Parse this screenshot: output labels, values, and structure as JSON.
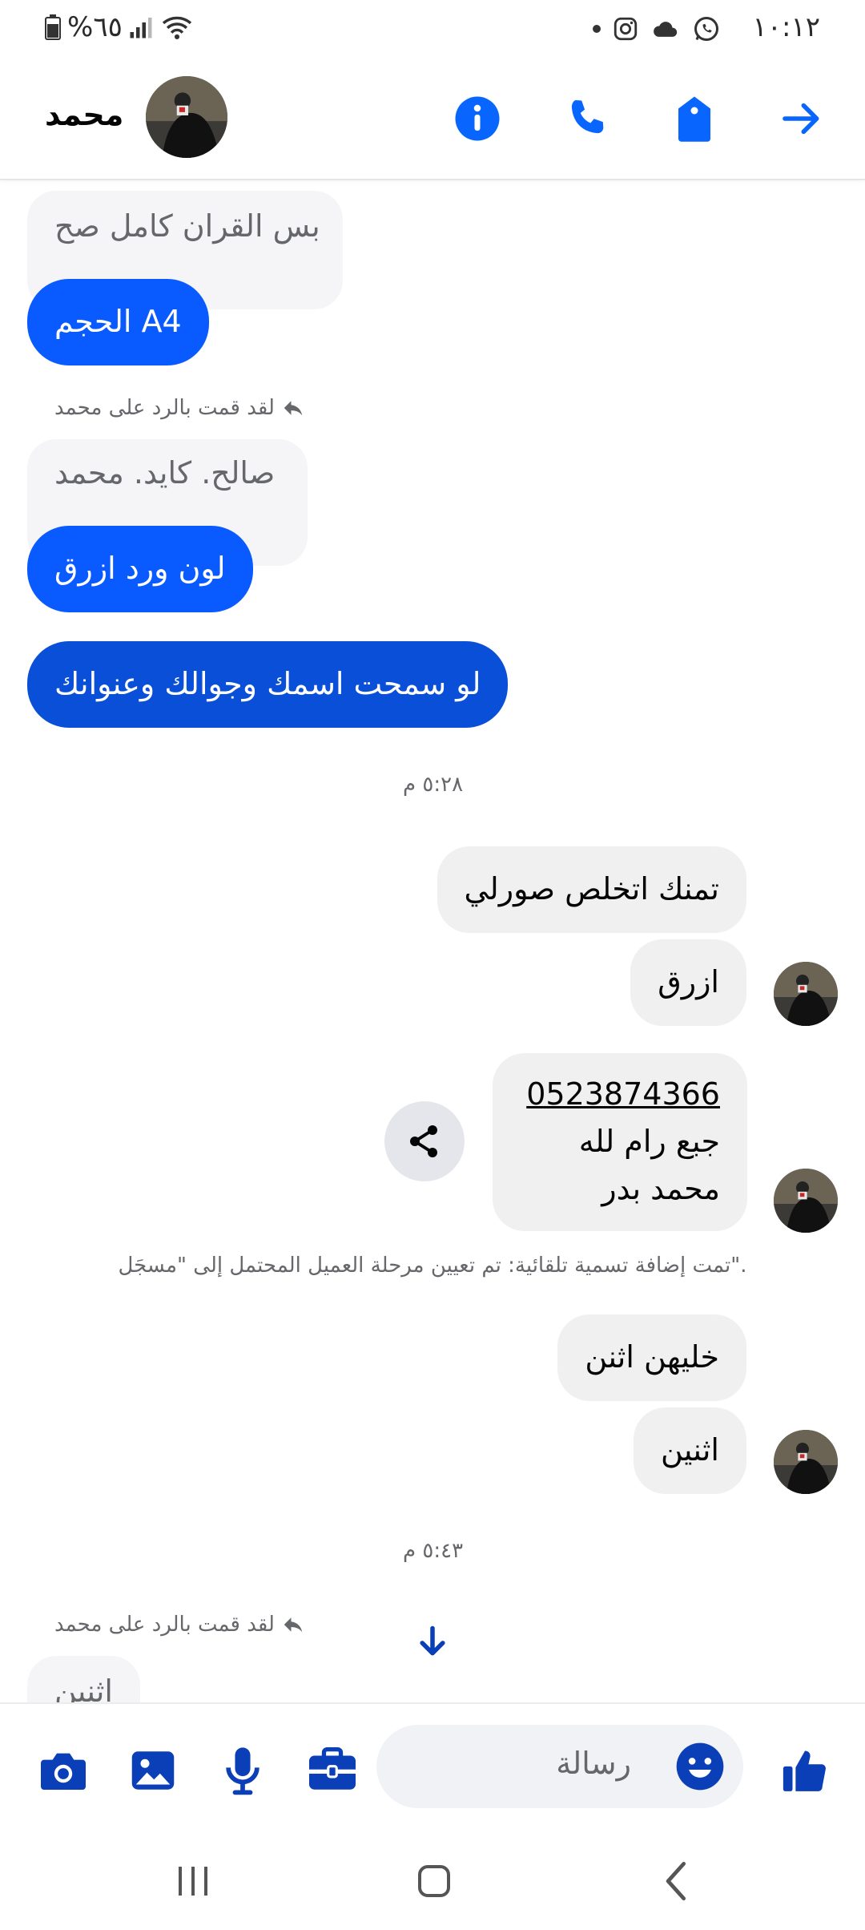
{
  "status_bar": {
    "time": "١٠:١٢",
    "battery": "%٦٥",
    "icons": [
      "dot",
      "instagram-icon",
      "cloud-icon",
      "whatsapp-icon",
      "signal-icon",
      "wifi-icon",
      "battery-icon"
    ]
  },
  "header": {
    "contact_name": "محمد",
    "icons": [
      "info-icon",
      "phone-icon",
      "tag-icon",
      "back-arrow-icon"
    ],
    "accent_color": "#0866ff"
  },
  "messages": {
    "quoted_1": "بس القران كامل صح",
    "out_1": "الحجم A4",
    "reply_label_1": "لقد قمت بالرد على محمد",
    "quoted_2": "صالح. كايد. محمد",
    "out_2": "لون ورد ازرق",
    "out_3": "لو سمحت اسمك وجوالك وعنوانك",
    "time_1": "٥:٢٨ م",
    "in_1": "تمنك اتخلص صورلي",
    "in_2": "ازرق",
    "contact_phone": "0523874366",
    "contact_line_2": "جبع رام لله",
    "contact_line_3": "محمد بدر",
    "system_note": "تمت إضافة تسمية تلقائية: تم تعيين مرحلة العميل المحتمل إلى \"مسجَل\".",
    "in_3": "خليهن اثنن",
    "in_4": "اثنين",
    "time_2": "٥:٤٣ م",
    "reply_label_2": "لقد قمت بالرد على محمد",
    "quoted_3": "اثنين"
  },
  "composer": {
    "placeholder": "رسالة",
    "icons": [
      "camera-icon",
      "image-icon",
      "microphone-icon",
      "briefcase-icon",
      "emoji-icon",
      "like-icon"
    ]
  },
  "nav_bar": {
    "icons": [
      "recent-apps-icon",
      "home-icon",
      "back-icon"
    ]
  },
  "colors": {
    "outgoing_bubble": "#0a5bff",
    "incoming_bubble": "#f0f0f0",
    "icon_blue": "#0866ff"
  }
}
